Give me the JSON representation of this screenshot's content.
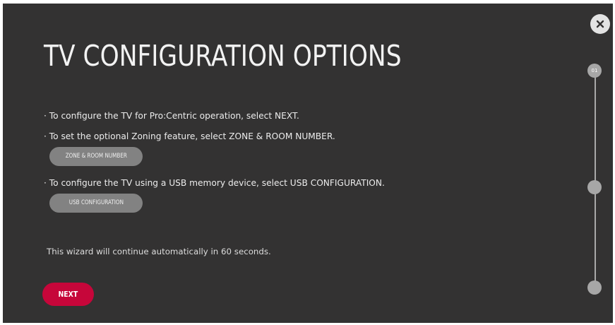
{
  "header": {
    "title": "TV CONFIGURATION OPTIONS",
    "close_icon": "close-icon"
  },
  "instructions": {
    "line_next": "· To configure the TV for Pro:Centric operation, select NEXT.",
    "line_zone": "· To set the optional Zoning feature, select ZONE & ROOM NUMBER.",
    "line_usb": "· To configure the TV using a USB memory device, select USB CONFIGURATION."
  },
  "buttons": {
    "zone_room": "ZONE & ROOM NUMBER",
    "usb_config": "USB CONFIGURATION",
    "next": "NEXT"
  },
  "wizard": {
    "note": "This wizard will continue automatically in 60 seconds."
  },
  "steps": {
    "current_label": "01",
    "total": 3,
    "current": 1
  },
  "colors": {
    "background": "#333232",
    "accent": "#c6063a",
    "pill": "#828282",
    "step": "#a7a7a7"
  }
}
